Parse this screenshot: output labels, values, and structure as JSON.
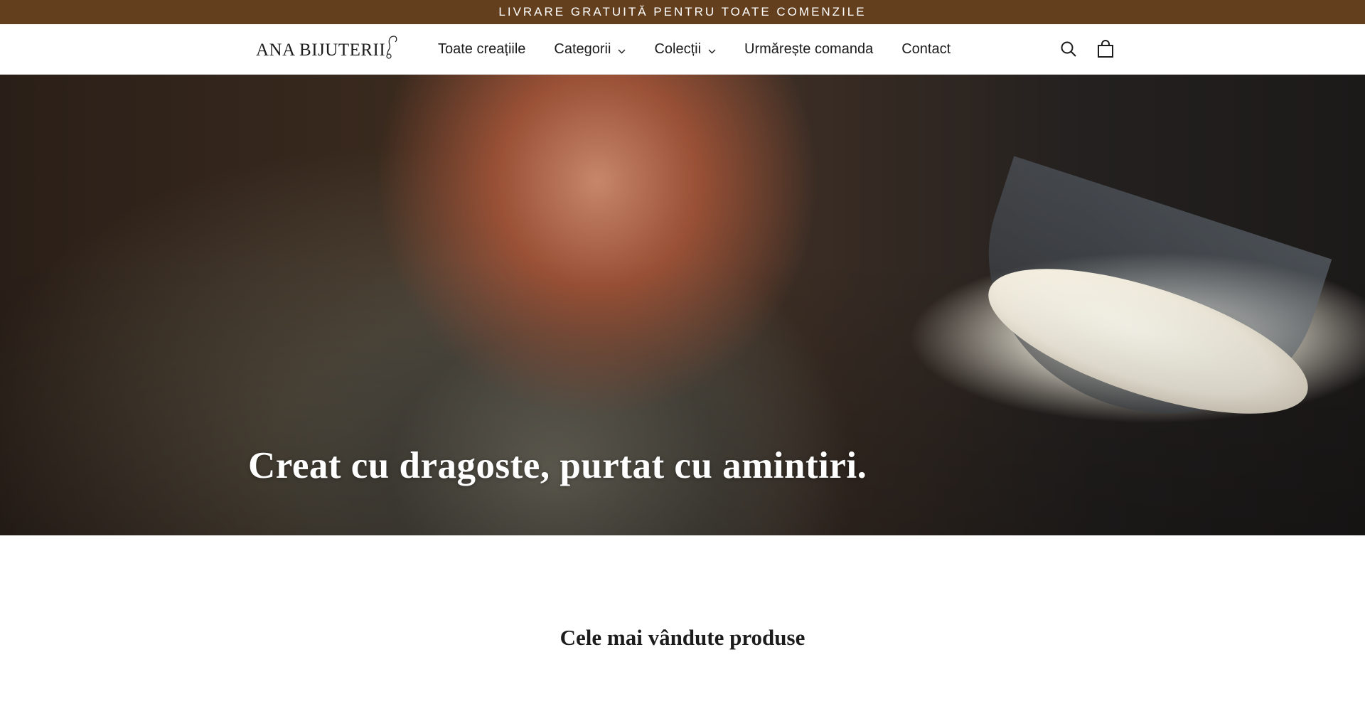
{
  "announcement": {
    "text": "LIVRARE GRATUITĂ PENTRU TOATE COMENZILE"
  },
  "header": {
    "logo_text": "ANA BIJUTERII",
    "logo_icon": "earring-icon",
    "nav": [
      {
        "label": "Toate creațiile",
        "dropdown": false
      },
      {
        "label": "Categorii",
        "dropdown": true
      },
      {
        "label": "Colecții",
        "dropdown": true
      },
      {
        "label": "Urmărește comanda",
        "dropdown": false
      },
      {
        "label": "Contact",
        "dropdown": false
      }
    ],
    "icons": [
      "search-icon",
      "cart-icon"
    ]
  },
  "hero": {
    "title": "Creat cu dragoste, purtat cu amintiri.",
    "image": "woman-with-glasses-at-workbench-lamp"
  },
  "bestsellers": {
    "title": "Cele mai vândute produse"
  },
  "colors": {
    "announcement_bg": "#643f1d",
    "text": "#1c1c1c",
    "background": "#ffffff"
  }
}
